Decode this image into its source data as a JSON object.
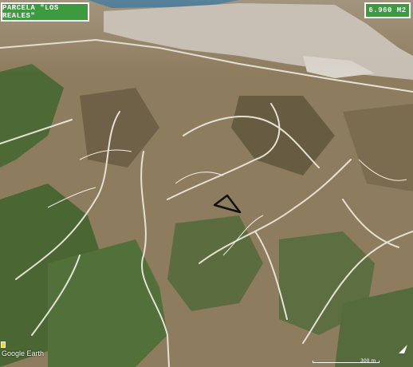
{
  "map": {
    "title": "PARCELA \"LOS REALES\"",
    "area": "6.960 M2",
    "attribution": "Google Earth",
    "scale_label": "300 m",
    "icons": [
      "parcel-outline",
      "north-arrow-icon",
      "google-earth-badge-icon"
    ]
  },
  "colors": {
    "label_background": "#3d9a3f",
    "label_text": "#ffffff",
    "parcel_outline": "#111111",
    "sea": "#1b5f8a",
    "urban": "#c8bfb4",
    "vegetation": "#4d6a36",
    "terrain": "#8e7c5e",
    "roads": "#e6e1d6"
  }
}
